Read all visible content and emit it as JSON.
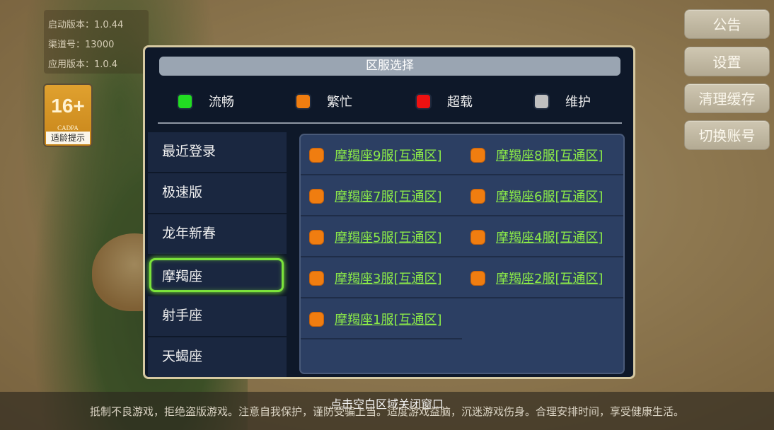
{
  "version_info": {
    "launch_version": "启动版本：1.0.44",
    "channel": "渠道号：13000",
    "app_version": "应用版本：1.0.4"
  },
  "age_rating": {
    "age": "16+",
    "org": "CADPA",
    "tip": "适龄提示"
  },
  "side_buttons": {
    "announcement": "公告",
    "settings": "设置",
    "clear_cache": "清理缓存",
    "switch_account": "切换账号"
  },
  "dialog": {
    "title": "区服选择",
    "legend": [
      {
        "label": "流畅",
        "color": "#22dd22"
      },
      {
        "label": "繁忙",
        "color": "#f07d10"
      },
      {
        "label": "超载",
        "color": "#ee1111"
      },
      {
        "label": "维护",
        "color": "#c0c0c0"
      }
    ],
    "categories": [
      "最近登录",
      "极速版",
      "龙年新春",
      "摩羯座",
      "射手座",
      "天蝎座"
    ],
    "active_category": "摩羯座",
    "servers": [
      "摩羯座9服[互通区]",
      "摩羯座8服[互通区]",
      "摩羯座7服[互通区]",
      "摩羯座6服[互通区]",
      "摩羯座5服[互通区]",
      "摩羯座4服[互通区]",
      "摩羯座3服[互通区]",
      "摩羯座2服[互通区]",
      "摩羯座1服[互通区]"
    ],
    "server_status_color": "#f07d10"
  },
  "close_hint": "点击空白区域关闭窗口",
  "anti_addiction": "抵制不良游戏，拒绝盗版游戏。注意自我保护，谨防受骗上当。适度游戏益脑，沉迷游戏伤身。合理安排时间，享受健康生活。"
}
